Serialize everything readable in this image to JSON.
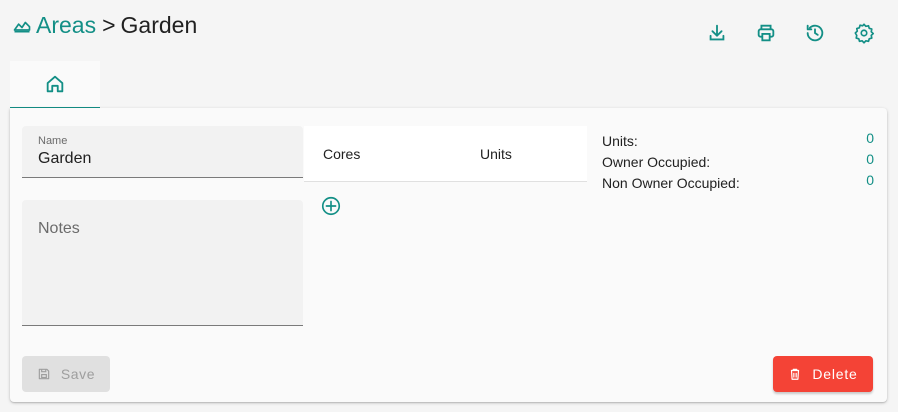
{
  "header": {
    "breadcrumb_link": "Areas",
    "separator": ">",
    "current": "Garden",
    "icon": "area-chart-icon"
  },
  "toolbar": {
    "items": [
      {
        "icon": "download-icon"
      },
      {
        "icon": "print-icon"
      },
      {
        "icon": "history-icon"
      },
      {
        "icon": "settings-icon"
      }
    ]
  },
  "tabs": [
    {
      "icon": "home-icon",
      "active": true
    }
  ],
  "form": {
    "name_label": "Name",
    "name_value": "Garden",
    "notes_placeholder": "Notes"
  },
  "cores_table": {
    "columns": [
      "Cores",
      "Units"
    ]
  },
  "stats": [
    {
      "label": "Units:",
      "value": "0"
    },
    {
      "label": "Owner Occupied:",
      "value": "0"
    },
    {
      "label": "Non Owner Occupied:",
      "value": "0"
    }
  ],
  "actions": {
    "save_label": "Save",
    "delete_label": "Delete"
  },
  "colors": {
    "accent": "#138f86",
    "danger": "#f44336",
    "disabled_bg": "#e0e0e0",
    "disabled_text": "#9e9e9e"
  }
}
